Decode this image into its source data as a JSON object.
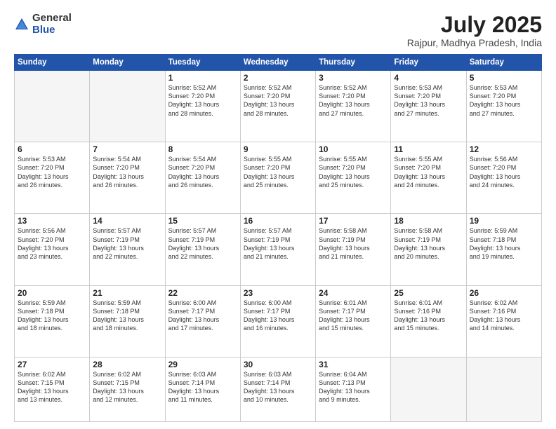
{
  "logo": {
    "general": "General",
    "blue": "Blue"
  },
  "title": "July 2025",
  "location": "Rajpur, Madhya Pradesh, India",
  "days_header": [
    "Sunday",
    "Monday",
    "Tuesday",
    "Wednesday",
    "Thursday",
    "Friday",
    "Saturday"
  ],
  "weeks": [
    [
      {
        "day": "",
        "info": ""
      },
      {
        "day": "",
        "info": ""
      },
      {
        "day": "1",
        "info": "Sunrise: 5:52 AM\nSunset: 7:20 PM\nDaylight: 13 hours\nand 28 minutes."
      },
      {
        "day": "2",
        "info": "Sunrise: 5:52 AM\nSunset: 7:20 PM\nDaylight: 13 hours\nand 28 minutes."
      },
      {
        "day": "3",
        "info": "Sunrise: 5:52 AM\nSunset: 7:20 PM\nDaylight: 13 hours\nand 27 minutes."
      },
      {
        "day": "4",
        "info": "Sunrise: 5:53 AM\nSunset: 7:20 PM\nDaylight: 13 hours\nand 27 minutes."
      },
      {
        "day": "5",
        "info": "Sunrise: 5:53 AM\nSunset: 7:20 PM\nDaylight: 13 hours\nand 27 minutes."
      }
    ],
    [
      {
        "day": "6",
        "info": "Sunrise: 5:53 AM\nSunset: 7:20 PM\nDaylight: 13 hours\nand 26 minutes."
      },
      {
        "day": "7",
        "info": "Sunrise: 5:54 AM\nSunset: 7:20 PM\nDaylight: 13 hours\nand 26 minutes."
      },
      {
        "day": "8",
        "info": "Sunrise: 5:54 AM\nSunset: 7:20 PM\nDaylight: 13 hours\nand 26 minutes."
      },
      {
        "day": "9",
        "info": "Sunrise: 5:55 AM\nSunset: 7:20 PM\nDaylight: 13 hours\nand 25 minutes."
      },
      {
        "day": "10",
        "info": "Sunrise: 5:55 AM\nSunset: 7:20 PM\nDaylight: 13 hours\nand 25 minutes."
      },
      {
        "day": "11",
        "info": "Sunrise: 5:55 AM\nSunset: 7:20 PM\nDaylight: 13 hours\nand 24 minutes."
      },
      {
        "day": "12",
        "info": "Sunrise: 5:56 AM\nSunset: 7:20 PM\nDaylight: 13 hours\nand 24 minutes."
      }
    ],
    [
      {
        "day": "13",
        "info": "Sunrise: 5:56 AM\nSunset: 7:20 PM\nDaylight: 13 hours\nand 23 minutes."
      },
      {
        "day": "14",
        "info": "Sunrise: 5:57 AM\nSunset: 7:19 PM\nDaylight: 13 hours\nand 22 minutes."
      },
      {
        "day": "15",
        "info": "Sunrise: 5:57 AM\nSunset: 7:19 PM\nDaylight: 13 hours\nand 22 minutes."
      },
      {
        "day": "16",
        "info": "Sunrise: 5:57 AM\nSunset: 7:19 PM\nDaylight: 13 hours\nand 21 minutes."
      },
      {
        "day": "17",
        "info": "Sunrise: 5:58 AM\nSunset: 7:19 PM\nDaylight: 13 hours\nand 21 minutes."
      },
      {
        "day": "18",
        "info": "Sunrise: 5:58 AM\nSunset: 7:19 PM\nDaylight: 13 hours\nand 20 minutes."
      },
      {
        "day": "19",
        "info": "Sunrise: 5:59 AM\nSunset: 7:18 PM\nDaylight: 13 hours\nand 19 minutes."
      }
    ],
    [
      {
        "day": "20",
        "info": "Sunrise: 5:59 AM\nSunset: 7:18 PM\nDaylight: 13 hours\nand 18 minutes."
      },
      {
        "day": "21",
        "info": "Sunrise: 5:59 AM\nSunset: 7:18 PM\nDaylight: 13 hours\nand 18 minutes."
      },
      {
        "day": "22",
        "info": "Sunrise: 6:00 AM\nSunset: 7:17 PM\nDaylight: 13 hours\nand 17 minutes."
      },
      {
        "day": "23",
        "info": "Sunrise: 6:00 AM\nSunset: 7:17 PM\nDaylight: 13 hours\nand 16 minutes."
      },
      {
        "day": "24",
        "info": "Sunrise: 6:01 AM\nSunset: 7:17 PM\nDaylight: 13 hours\nand 15 minutes."
      },
      {
        "day": "25",
        "info": "Sunrise: 6:01 AM\nSunset: 7:16 PM\nDaylight: 13 hours\nand 15 minutes."
      },
      {
        "day": "26",
        "info": "Sunrise: 6:02 AM\nSunset: 7:16 PM\nDaylight: 13 hours\nand 14 minutes."
      }
    ],
    [
      {
        "day": "27",
        "info": "Sunrise: 6:02 AM\nSunset: 7:15 PM\nDaylight: 13 hours\nand 13 minutes."
      },
      {
        "day": "28",
        "info": "Sunrise: 6:02 AM\nSunset: 7:15 PM\nDaylight: 13 hours\nand 12 minutes."
      },
      {
        "day": "29",
        "info": "Sunrise: 6:03 AM\nSunset: 7:14 PM\nDaylight: 13 hours\nand 11 minutes."
      },
      {
        "day": "30",
        "info": "Sunrise: 6:03 AM\nSunset: 7:14 PM\nDaylight: 13 hours\nand 10 minutes."
      },
      {
        "day": "31",
        "info": "Sunrise: 6:04 AM\nSunset: 7:13 PM\nDaylight: 13 hours\nand 9 minutes."
      },
      {
        "day": "",
        "info": ""
      },
      {
        "day": "",
        "info": ""
      }
    ]
  ]
}
